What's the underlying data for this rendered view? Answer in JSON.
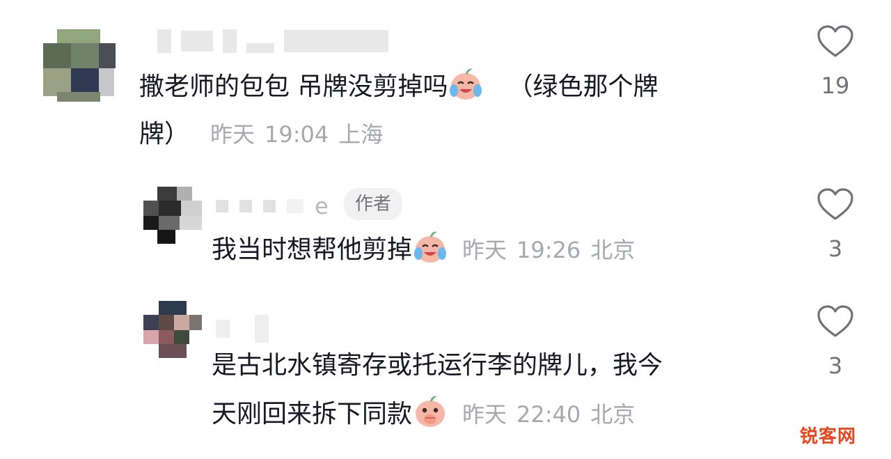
{
  "comments": [
    {
      "text_line1": "撒老师的包包 吊牌没剪掉吗",
      "text_line1_tail": "（绿色那个牌",
      "text_line2": "牌）",
      "meta": {
        "date": "昨天",
        "time": "19:04",
        "location": "上海"
      },
      "likes": "19",
      "emoji": "crying-laugh-emoji"
    },
    {
      "name_suffix": "e",
      "badge": "作者",
      "text_line1": "我当时想帮他剪掉",
      "meta": {
        "date": "昨天",
        "time": "19:26",
        "location": "北京"
      },
      "likes": "3",
      "emoji": "crying-laugh-emoji"
    },
    {
      "text_line1": "是古北水镇寄存或托运行李的牌儿，我今",
      "text_line2": "天刚回来拆下同款",
      "meta": {
        "date": "昨天",
        "time": "22:40",
        "location": "北京"
      },
      "likes": "3",
      "emoji": "covering-mouth-emoji"
    }
  ],
  "watermark": "锐客网",
  "colors": {
    "text": "#161823",
    "meta": "#a6a8ad",
    "badge_bg": "#f1f1f2",
    "watermark": "#e8471f"
  }
}
